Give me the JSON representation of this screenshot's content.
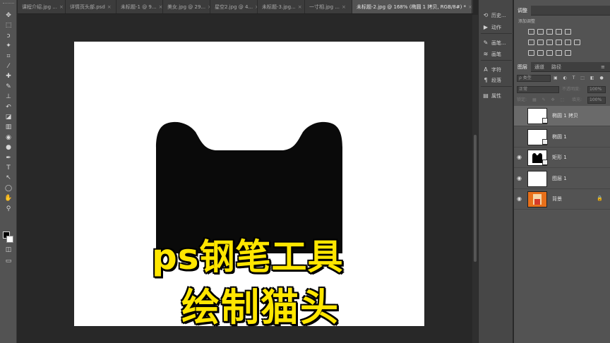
{
  "tabs": [
    {
      "label": "课程介绍.jpg ..."
    },
    {
      "label": "详情页头部.psd"
    },
    {
      "label": "未标题-1 @ 9..."
    },
    {
      "label": "美女.jpg @ 29..."
    },
    {
      "label": "星空2.jpg @ 4..."
    },
    {
      "label": "未标题-3.jpg..."
    },
    {
      "label": "一寸相.jpg ..."
    },
    {
      "label": "未标题-2.jpg @ 168% (椭圆 1 拷贝, RGB/8#) *",
      "active": true
    }
  ],
  "tab_close_glyph": "×",
  "tool_icons": [
    "move-tool-icon",
    "marquee-tool-icon",
    "lasso-tool-icon",
    "magic-wand-icon",
    "crop-tool-icon",
    "eyedropper-icon",
    "healing-brush-icon",
    "brush-tool-icon",
    "clone-stamp-icon",
    "history-brush-icon",
    "eraser-icon",
    "gradient-tool-icon",
    "blur-tool-icon",
    "dodge-tool-icon",
    "pen-tool-icon",
    "type-tool-icon",
    "path-selection-icon",
    "ellipse-tool-icon",
    "hand-tool-icon",
    "zoom-tool-icon"
  ],
  "tool_glyphs": [
    "✥",
    "⬚",
    "ↄ",
    "✦",
    "⌗",
    "⁄",
    "✚",
    "✎",
    "⊥",
    "↶",
    "◪",
    "▥",
    "◉",
    "●",
    "✒",
    "T",
    "↖",
    "◯",
    "✋",
    "⚲"
  ],
  "overlay_title": {
    "line1": "ps钢笔工具",
    "line2": "绘制猫头",
    "color": "#ffe600"
  },
  "dock": [
    {
      "label": "历史...",
      "glyph": "⟲"
    },
    {
      "label": "动作",
      "glyph": "▶"
    },
    {
      "label": "画笔...",
      "glyph": "✎"
    },
    {
      "label": "画笔",
      "glyph": "≋"
    },
    {
      "label": "字符",
      "glyph": "A"
    },
    {
      "label": "段落",
      "glyph": "¶"
    },
    {
      "label": "属性",
      "glyph": "▤"
    }
  ],
  "adjustments": {
    "tab": "调整",
    "add_label": "添加调整"
  },
  "layers_panel": {
    "tabs": [
      "图层",
      "通道",
      "路径"
    ],
    "filter_kind": "ρ 类型",
    "blend_mode": "正常",
    "opacity_label": "不透明度:",
    "opacity_value": "100%",
    "lock_label": "锁定:",
    "fill_label": "填充:",
    "fill_value": "100%",
    "layers": [
      {
        "name": "椭圆 1 拷贝",
        "visible": false,
        "selected": true,
        "thumb": "transparent"
      },
      {
        "name": "椭圆 1",
        "visible": false,
        "selected": false,
        "thumb": "transparent"
      },
      {
        "name": "矩形 1",
        "visible": true,
        "selected": false,
        "thumb": "shape"
      },
      {
        "name": "图层 1",
        "visible": true,
        "selected": false,
        "thumb": "white"
      },
      {
        "name": "背景",
        "visible": true,
        "selected": false,
        "thumb": "photo",
        "locked": true
      }
    ],
    "eye_glyph": "◉",
    "lock_glyph": "🔒"
  }
}
